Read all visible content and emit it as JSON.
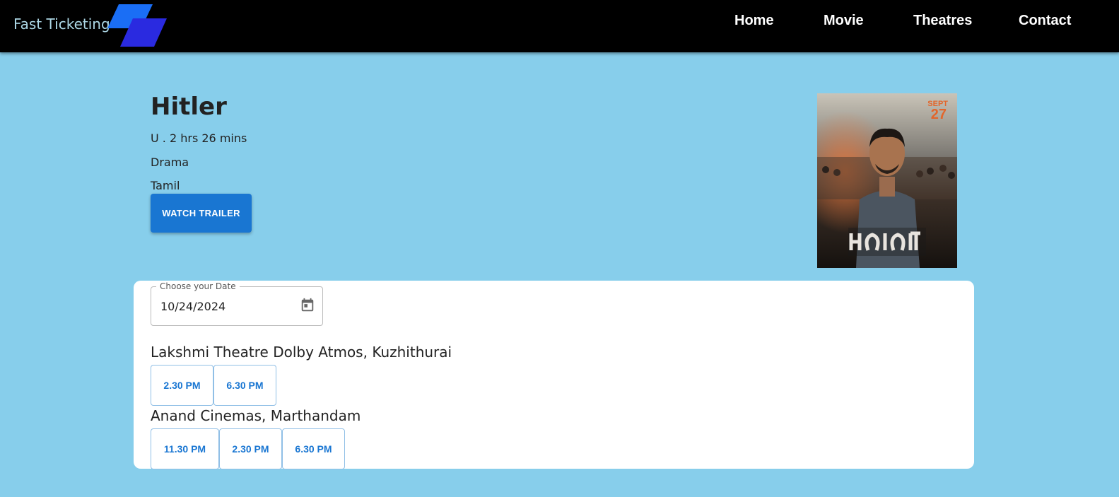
{
  "brand": {
    "name": "Fast Ticketing"
  },
  "nav": [
    "Home",
    "Movie",
    "Theatres",
    "Contact"
  ],
  "movie": {
    "title": "Hitler",
    "rating_duration": "U . 2 hrs 26 mins",
    "genre": "Drama",
    "language": "Tamil",
    "trailer_label": "WATCH TRAILER",
    "poster_alt": "Hitler movie poster"
  },
  "date_picker": {
    "label": "Choose your Date",
    "value": "10/24/2024",
    "icon": "calendar-icon"
  },
  "theatres": [
    {
      "name": "Lakshmi Theatre Dolby Atmos, Kuzhithurai",
      "showtimes": [
        "2.30 PM",
        "6.30 PM"
      ]
    },
    {
      "name": "Anand Cinemas, Marthandam",
      "showtimes": [
        "11.30 PM",
        "2.30 PM",
        "6.30 PM"
      ]
    }
  ],
  "colors": {
    "background": "#87CEEB",
    "navbar": "#000000",
    "accent": "#1976d2",
    "brand_text": "#add8e6"
  }
}
